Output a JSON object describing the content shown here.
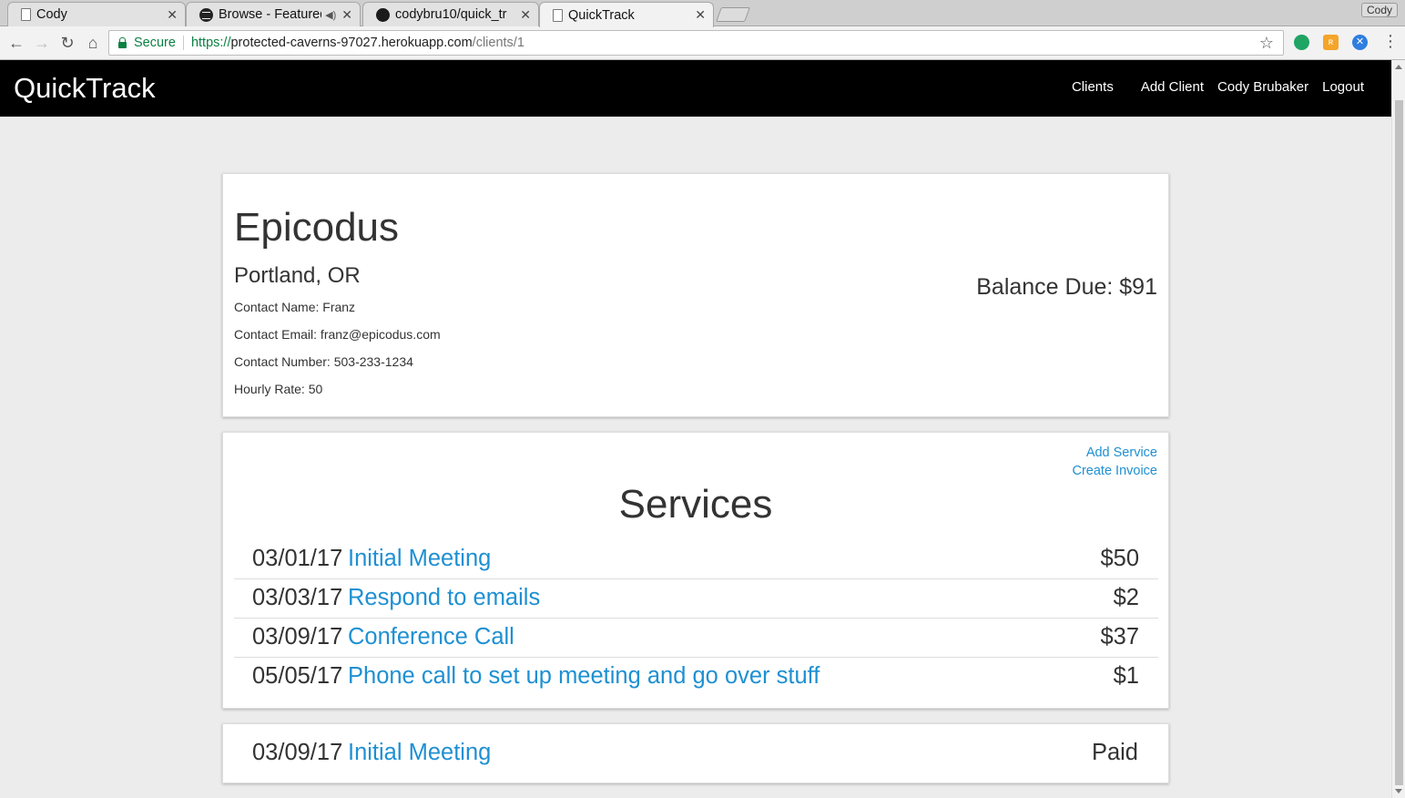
{
  "browser": {
    "tabs": [
      {
        "title": "Cody",
        "favicon": "document-icon",
        "active": false
      },
      {
        "title": "Browse - Featured",
        "favicon": "spotify-icon",
        "active": false,
        "audio": true
      },
      {
        "title": "codybru10/quick_tr",
        "favicon": "github-icon",
        "active": false
      },
      {
        "title": "QuickTrack",
        "favicon": "document-icon",
        "active": true
      }
    ],
    "profile": "Cody",
    "secure_label": "Secure",
    "url": {
      "scheme": "https://",
      "host": "protected-caverns-97027.herokuapp.com",
      "path": "/clients/1"
    }
  },
  "navbar": {
    "brand": "QuickTrack",
    "links": {
      "clients": "Clients",
      "add_client": "Add Client",
      "user": "Cody Brubaker",
      "logout": "Logout"
    }
  },
  "client": {
    "name": "Epicodus",
    "location": "Portland, OR",
    "contact_name": "Contact Name: Franz",
    "contact_email": "Contact Email: franz@epicodus.com",
    "contact_number": "Contact Number: 503-233-1234",
    "hourly_rate": "Hourly Rate: 50",
    "balance_due": "Balance Due: $91"
  },
  "services": {
    "add_service": "Add Service",
    "create_invoice": "Create Invoice",
    "title": "Services",
    "items": [
      {
        "date": "03/01/17",
        "name": "Initial Meeting",
        "price": "$50"
      },
      {
        "date": "03/03/17",
        "name": "Respond to emails",
        "price": "$2"
      },
      {
        "date": "03/09/17",
        "name": "Conference Call",
        "price": "$37"
      },
      {
        "date": "05/05/17",
        "name": "Phone call to set up meeting and go over stuff",
        "price": "$1"
      }
    ]
  },
  "invoices": [
    {
      "date": "03/09/17",
      "name": "Initial Meeting",
      "status": "Paid"
    }
  ],
  "colors": {
    "navbar_bg": "#000000",
    "link": "#1e90d2",
    "page_bg": "#ececec",
    "secure_green": "#0b8043"
  }
}
